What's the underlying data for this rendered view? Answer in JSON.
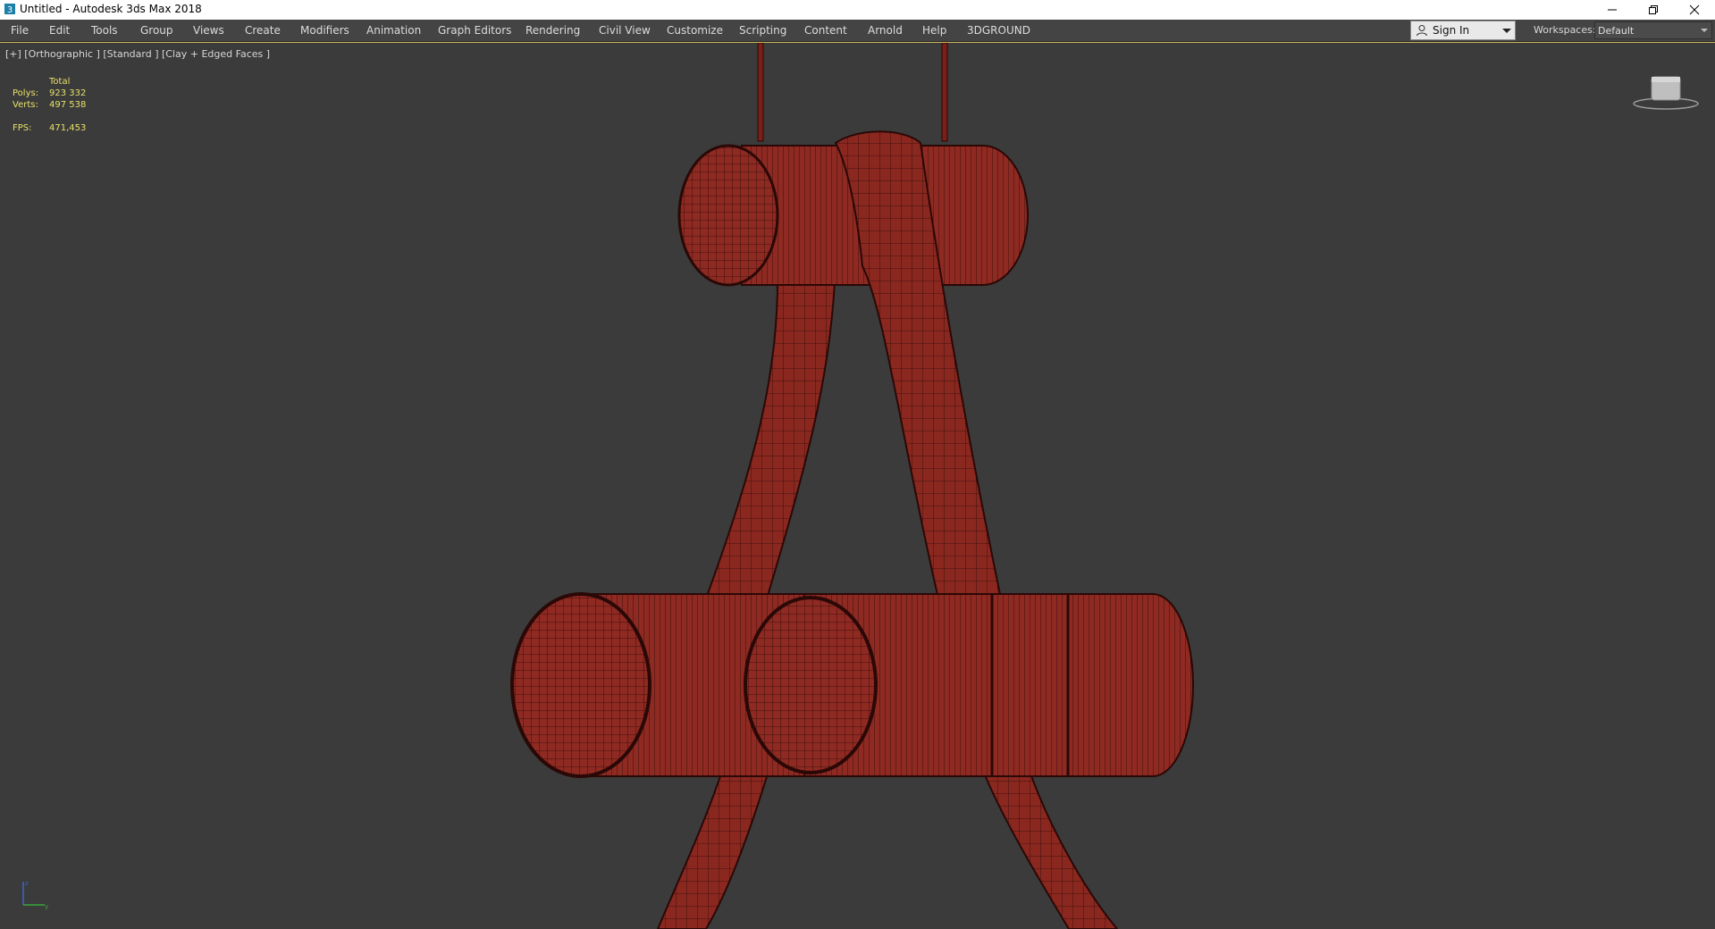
{
  "window": {
    "title": "Untitled - Autodesk 3ds Max 2018",
    "controls": [
      "minimize-icon",
      "restore-icon",
      "close-icon"
    ]
  },
  "menu": {
    "items": [
      "File",
      "Edit",
      "Tools",
      "Group",
      "Views",
      "Create",
      "Modifiers",
      "Animation",
      "Graph Editors",
      "Rendering",
      "Civil View",
      "Customize",
      "Scripting",
      "Content",
      "Arnold",
      "Help",
      "3DGROUND"
    ]
  },
  "account": {
    "sign_in_label": "Sign In",
    "workspaces_label": "Workspaces:",
    "workspace_value": "Default"
  },
  "viewport": {
    "label": "[+] [Orthographic ] [Standard ] [Clay + Edged Faces ]",
    "stats": {
      "header": "Total",
      "polys_label": "Polys:",
      "polys_value": "923 332",
      "verts_label": "Verts:",
      "verts_value": "497 538",
      "fps_label": "FPS:",
      "fps_value": "471,453"
    },
    "viewcube_label": "ViewCube"
  },
  "colors": {
    "model_fill": "#8e2a22",
    "model_wire": "#2a0806",
    "viewport_bg": "#3b3b3b",
    "stats_text": "#e8e06a"
  }
}
